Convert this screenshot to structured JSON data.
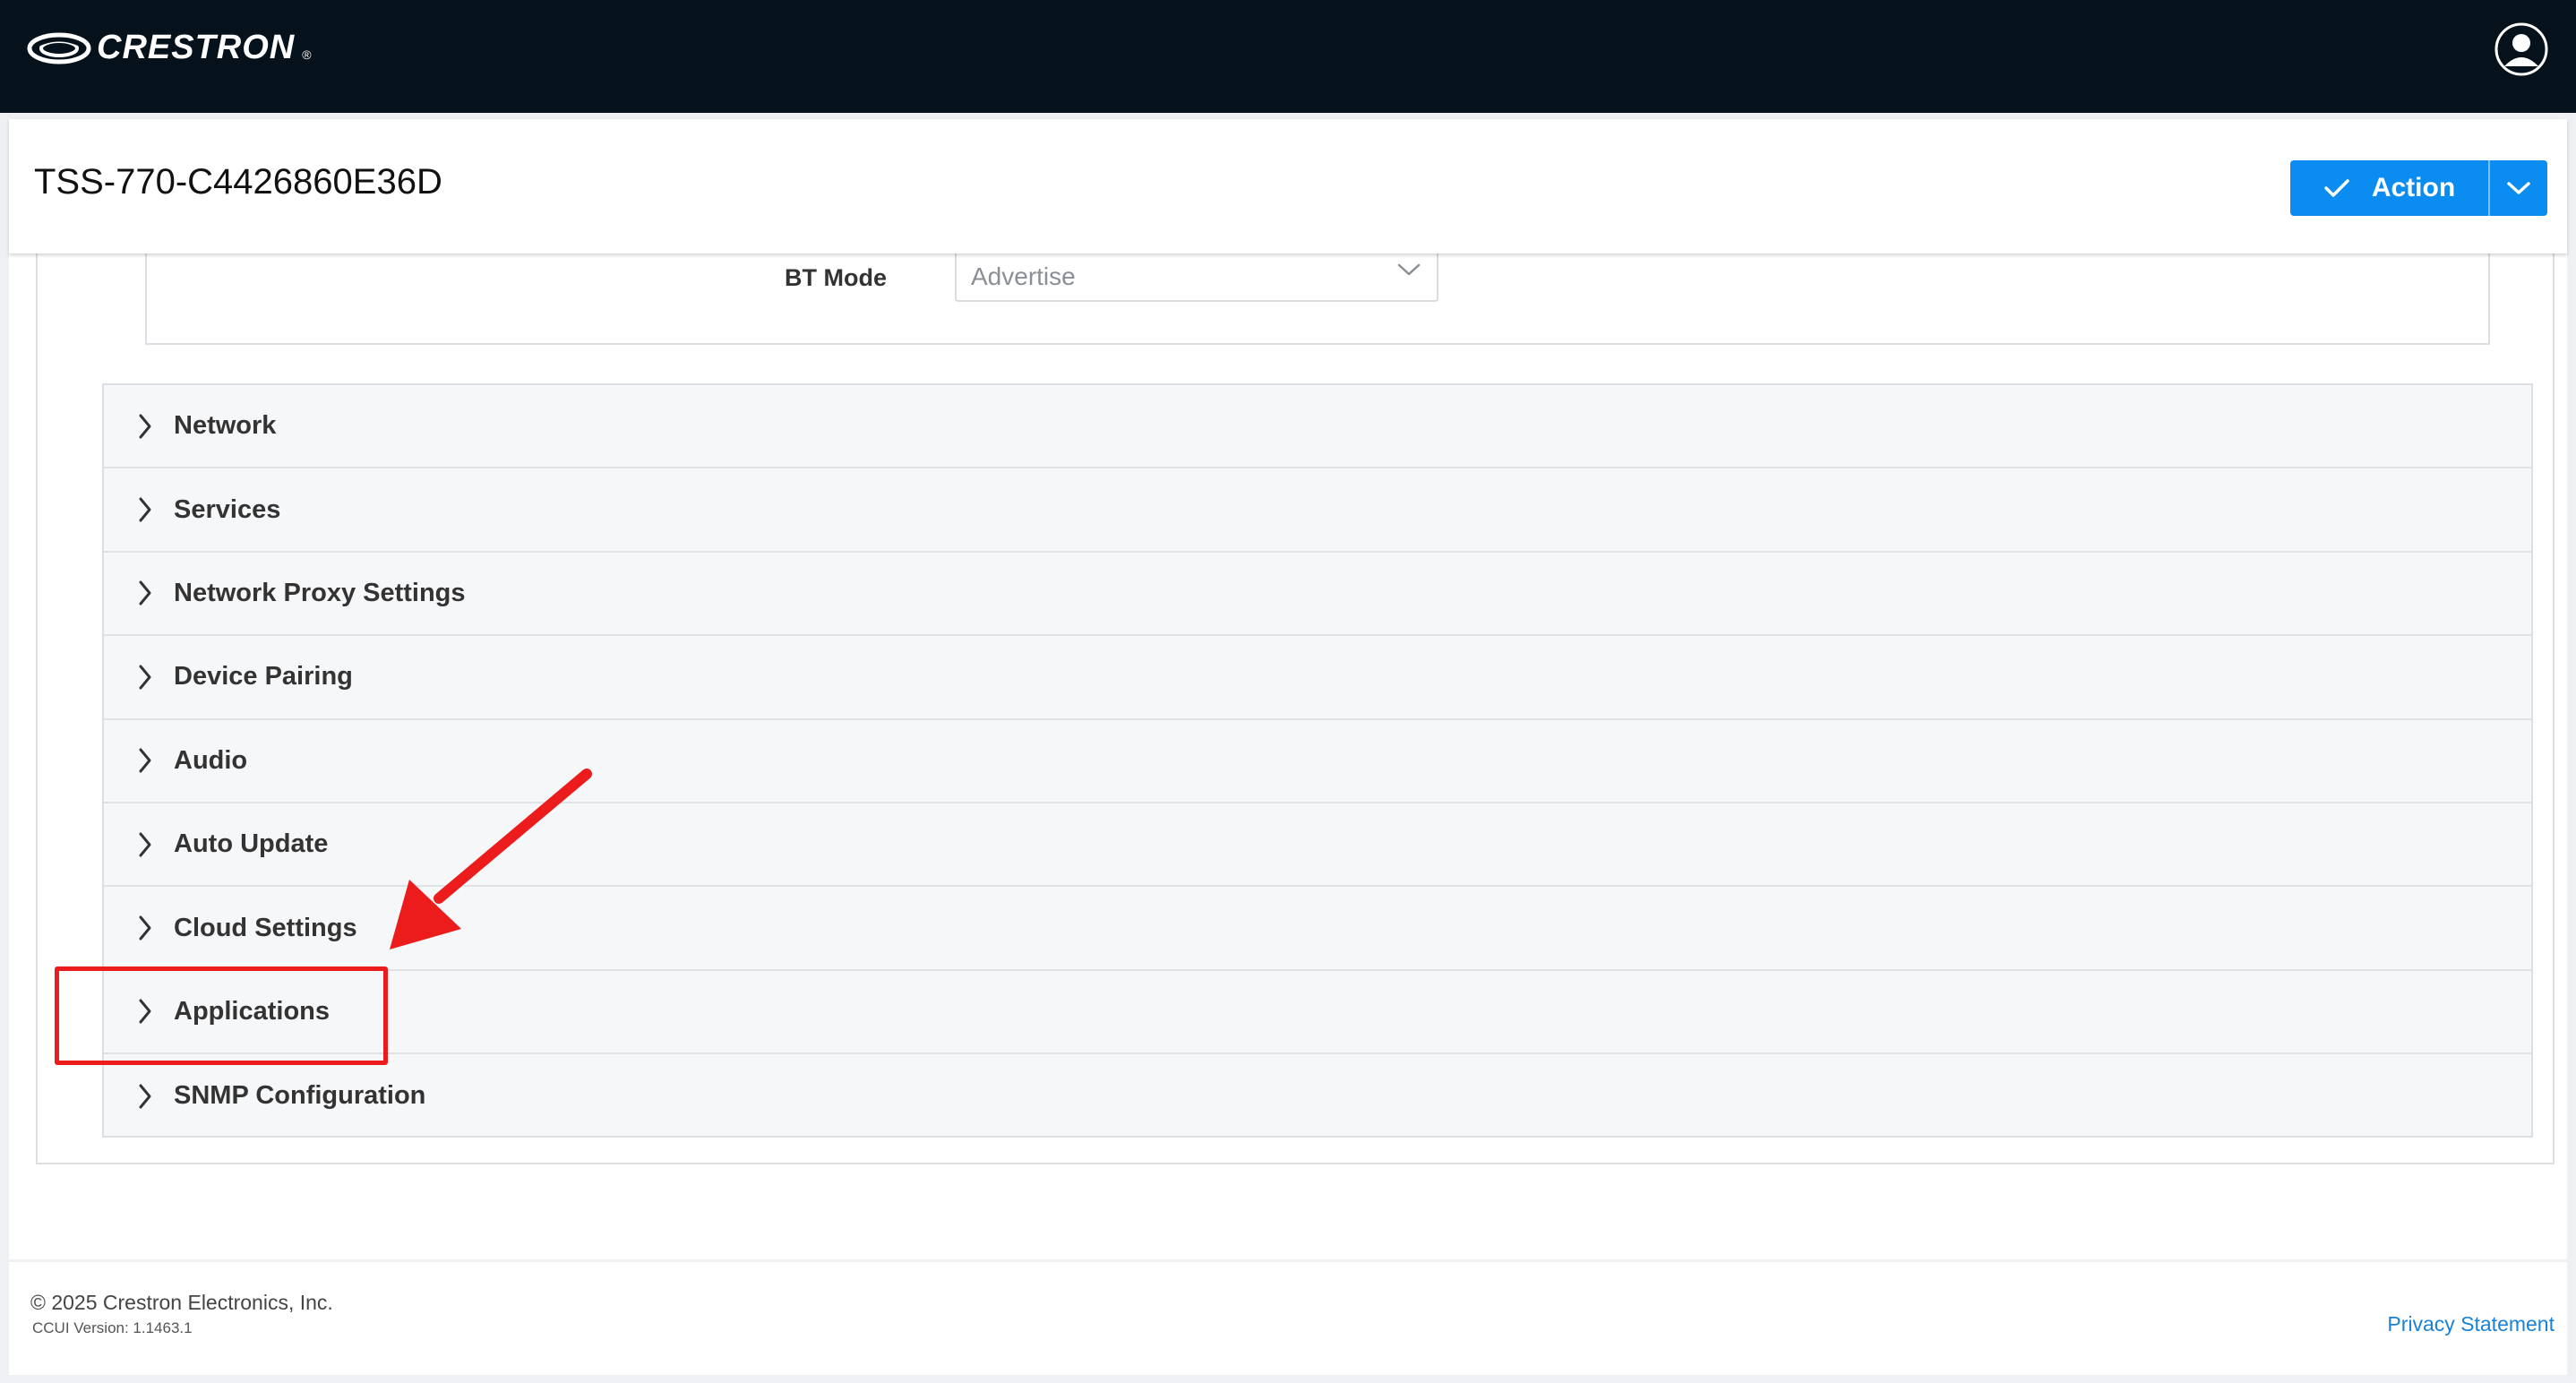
{
  "topbar": {
    "brand": "CRESTRON",
    "brand_mark": "®",
    "user_icon": "user-circle-icon"
  },
  "header": {
    "device_name": "TSS-770-C4426860E36D",
    "action_label": "Action",
    "action_icon": "checkmark-icon",
    "split_icon": "chevron-down-icon"
  },
  "bluetooth": {
    "mode_label": "BT Mode",
    "mode_value": "Advertise"
  },
  "accordion": {
    "items": [
      {
        "label": "Network"
      },
      {
        "label": "Services"
      },
      {
        "label": "Network Proxy Settings"
      },
      {
        "label": "Device Pairing"
      },
      {
        "label": "Audio"
      },
      {
        "label": "Auto Update"
      },
      {
        "label": "Cloud Settings"
      },
      {
        "label": "Applications"
      },
      {
        "label": "SNMP Configuration"
      }
    ]
  },
  "footer": {
    "copyright": "© 2025 Crestron Electronics, Inc.",
    "version": "CCUI Version: 1.1463.1",
    "privacy": "Privacy Statement"
  },
  "colors": {
    "topbar": "#06121b",
    "accent": "#0a8cf0",
    "annotation": "#ec1c1c",
    "link": "#1a82d6"
  }
}
